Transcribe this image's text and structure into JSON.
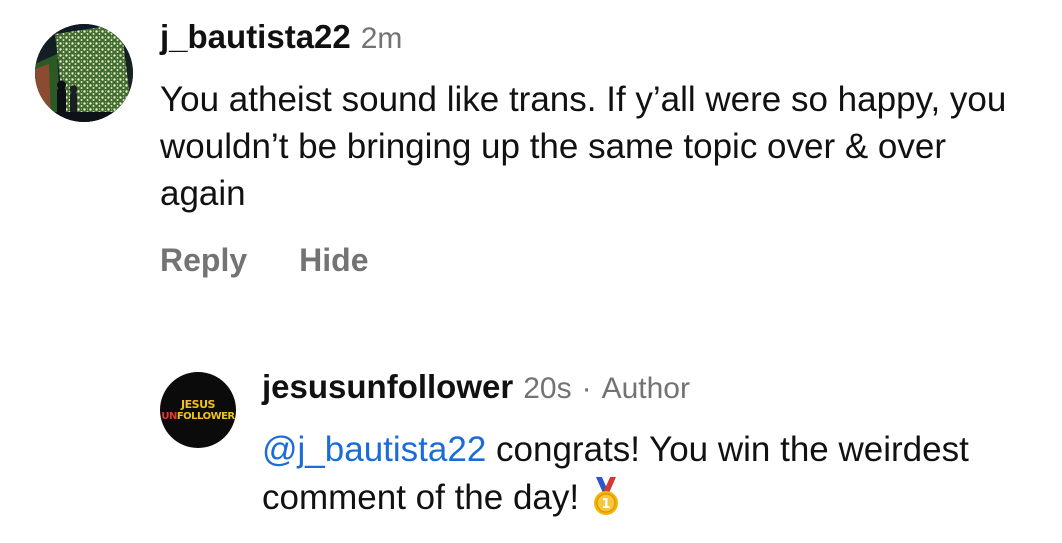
{
  "comment": {
    "username": "j_bautista22",
    "time": "2m",
    "text": "You atheist sound like trans. If y’all were so happy, you wouldn’t be bringing up the same topic over & over again",
    "actions": {
      "reply": "Reply",
      "hide": "Hide"
    }
  },
  "reply": {
    "username": "jesusunfollower",
    "time": "20s",
    "separator": "·",
    "badge": "Author",
    "avatar_logo": {
      "line1": "JESUS",
      "line2_first": "UN",
      "line2_rest": "FOLLOWER"
    },
    "mention": "@j_bautista22",
    "text": " congrats! You win the weirdest comment of the day!",
    "emoji": "medal-icon"
  },
  "colors": {
    "text_primary": "#111111",
    "text_secondary": "#737373",
    "mention_blue": "#1a6cd6",
    "logo_yellow": "#f2c21a",
    "logo_red": "#e23a2a",
    "medal_gold": "#f4b400"
  }
}
